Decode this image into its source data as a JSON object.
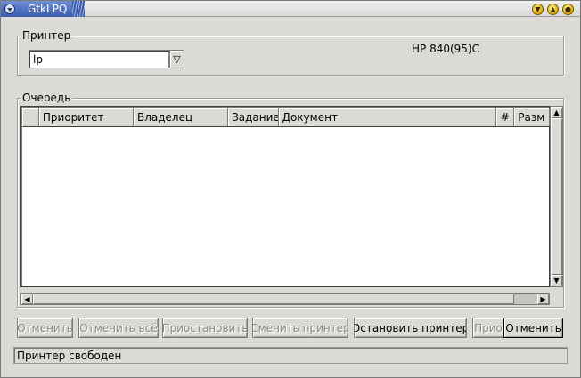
{
  "window": {
    "title": "GtkLPQ",
    "controls": {
      "minimize_icon": "minimize-icon",
      "maximize_icon": "maximize-icon",
      "close_icon": "close-icon"
    }
  },
  "printer_group": {
    "label": "Принтер",
    "printer_value": "lp",
    "model": "HP 840(95)C"
  },
  "queue_group": {
    "label": "Очередь",
    "columns": [
      "",
      "Приоритет",
      "Владелец",
      "Задание",
      "Документ",
      "#",
      "Разм"
    ],
    "rows": []
  },
  "buttons": {
    "cancel_job": "Отменить",
    "cancel_all": "Отменить всё",
    "pause": "Приостановить",
    "change_printer": "Сменить принтер",
    "stop_printer": "Остановить принтер",
    "prio": "Прио",
    "close": "Отменить"
  },
  "status": "Принтер свободен",
  "colors": {
    "title_active": "#3a5cae",
    "background": "#dcdad5"
  }
}
